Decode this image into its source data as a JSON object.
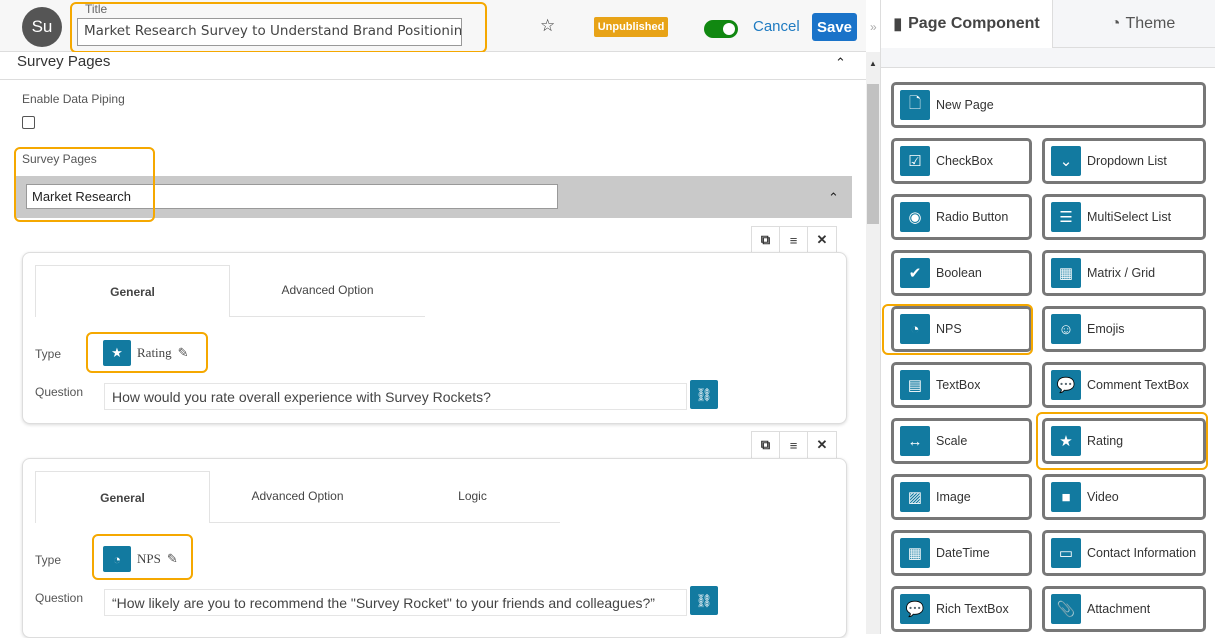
{
  "header": {
    "avatar": "Su",
    "title_label": "Title",
    "title_value": "Market Research Survey to Understand Brand Positioning",
    "status": "Unpublished",
    "cancel": "Cancel",
    "save": "Save",
    "toggle_on": true
  },
  "section": {
    "title": "Survey Pages",
    "enable_piping_label": "Enable Data Piping",
    "enable_piping_checked": false,
    "pages_label": "Survey Pages",
    "page_name": "Market Research"
  },
  "questions": [
    {
      "tabs": [
        "General",
        "Advanced Option"
      ],
      "type_label": "Type",
      "type": "Rating",
      "type_icon": "star-icon",
      "question_label": "Question",
      "question": "How would you rate overall experience with Survey Rockets?"
    },
    {
      "tabs": [
        "General",
        "Advanced Option",
        "Logic"
      ],
      "type_label": "Type",
      "type": "NPS",
      "type_icon": "dashboard-icon",
      "question_label": "Question",
      "question": "“How likely are you to recommend the \"Survey Rocket\" to your friends and colleagues?”"
    }
  ],
  "right_panel": {
    "tabs": [
      "Page Component",
      "Theme"
    ],
    "new_page": "New Page",
    "components": [
      {
        "label": "CheckBox",
        "icon": "checkbox-icon"
      },
      {
        "label": "Dropdown List",
        "icon": "chevron-down-icon"
      },
      {
        "label": "Radio Button",
        "icon": "radio-icon"
      },
      {
        "label": "MultiSelect List",
        "icon": "list-icon"
      },
      {
        "label": "Boolean",
        "icon": "check-icon"
      },
      {
        "label": "Matrix / Grid",
        "icon": "grid-icon"
      },
      {
        "label": "NPS",
        "icon": "dashboard-icon"
      },
      {
        "label": "Emojis",
        "icon": "smile-icon"
      },
      {
        "label": "TextBox",
        "icon": "file-text-icon"
      },
      {
        "label": "Comment TextBox",
        "icon": "comment-icon"
      },
      {
        "label": "Scale",
        "icon": "arrows-h-icon"
      },
      {
        "label": "Rating",
        "icon": "star-icon"
      },
      {
        "label": "Image",
        "icon": "image-icon"
      },
      {
        "label": "Video",
        "icon": "video-icon"
      },
      {
        "label": "DateTime",
        "icon": "calendar-icon"
      },
      {
        "label": "Contact Information",
        "icon": "contact-card-icon"
      },
      {
        "label": "Rich TextBox",
        "icon": "comment-icon"
      },
      {
        "label": "Attachment",
        "icon": "paperclip-icon"
      }
    ]
  },
  "colors": {
    "accent": "#127aa0",
    "highlight": "#f5a800",
    "save": "#1a73c9",
    "badge": "#e8a317",
    "toggle": "#118811"
  }
}
